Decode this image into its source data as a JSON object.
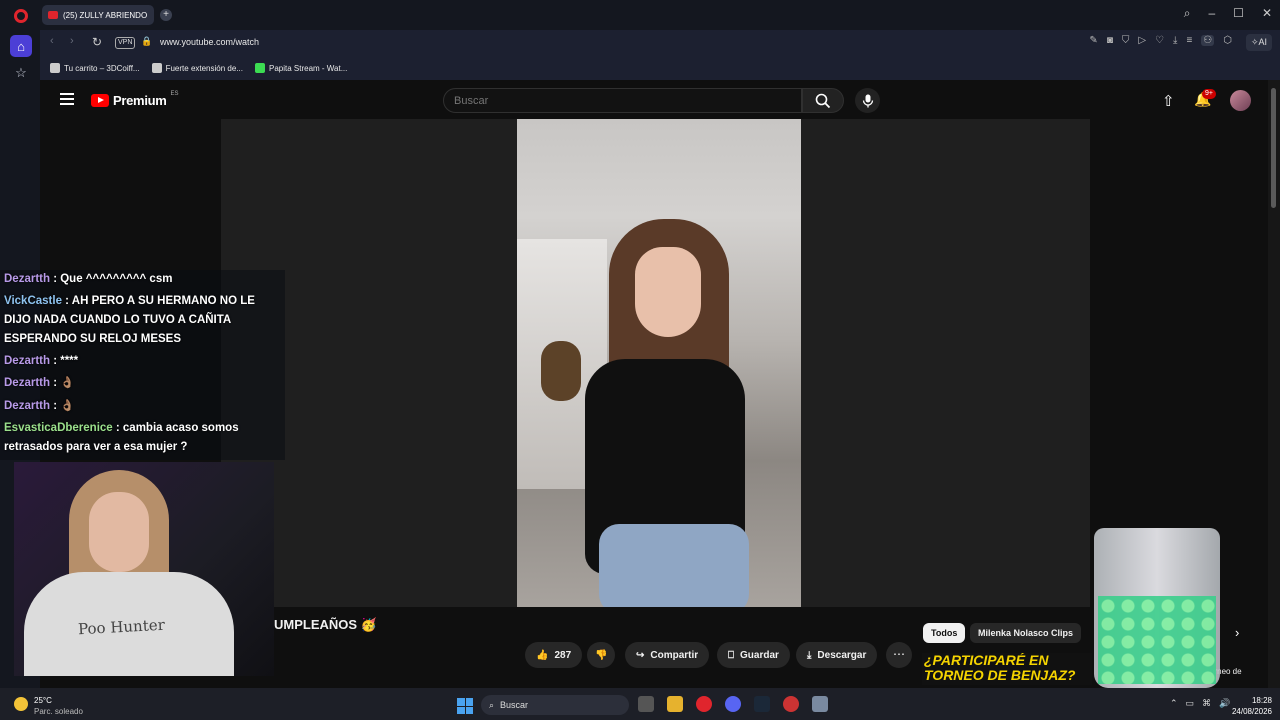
{
  "browser": {
    "tab_title": "(25) ZULLY ABRIENDO",
    "url": "www.youtube.com/watch",
    "vpn_label": "VPN",
    "aria_label": "AI",
    "bookmarks": [
      {
        "label": "Tu carrito – 3DCoiff..."
      },
      {
        "label": "Fuerte extensión de..."
      },
      {
        "label": "Papita Stream - Wat..."
      }
    ]
  },
  "youtube": {
    "logo": "Premium",
    "country": "ES",
    "search_placeholder": "Buscar",
    "notif_count": "9+",
    "video_title": "UMPLEAÑOS 🥳",
    "actions": {
      "likes": "287",
      "share": "Compartir",
      "save": "Guardar",
      "download": "Descargar"
    },
    "chips": [
      "Todos",
      "Milenka Nolasco Clips"
    ],
    "rec_thumb_lines": [
      "¿PARTICIPARÉ EN",
      "TORNEO DE BENJAZ?"
    ],
    "rec_title": "orneo de"
  },
  "chat": [
    {
      "user": "Dezartth",
      "text": " : Que ^^^^^^^^^ csm"
    },
    {
      "user": "VickCastle",
      "text": " : AH PERO A SU HERMANO NO LE DIJO NADA CUANDO LO TUVO A CAÑITA ESPERANDO SU RELOJ MESES"
    },
    {
      "user": "Dezartth",
      "text": " : ****"
    },
    {
      "user": "Dezartth",
      "text": " : 👌🏽"
    },
    {
      "user": "Dezartth",
      "text": " : 👌🏽"
    },
    {
      "user": "EsvasticaDberenice",
      "text": " : cambia acaso somos retrasados para ver a esa mujer ?"
    }
  ],
  "webcam": {
    "shirt_text": "Poo Hunter"
  },
  "taskbar": {
    "temperature": "25°C",
    "condition": "Parc. soleado",
    "search": "Buscar",
    "time": "18:28",
    "date": "24/08/2026"
  },
  "colors": {
    "brand_red": "#ff0000",
    "opera_accent": "#4c3fd6"
  }
}
